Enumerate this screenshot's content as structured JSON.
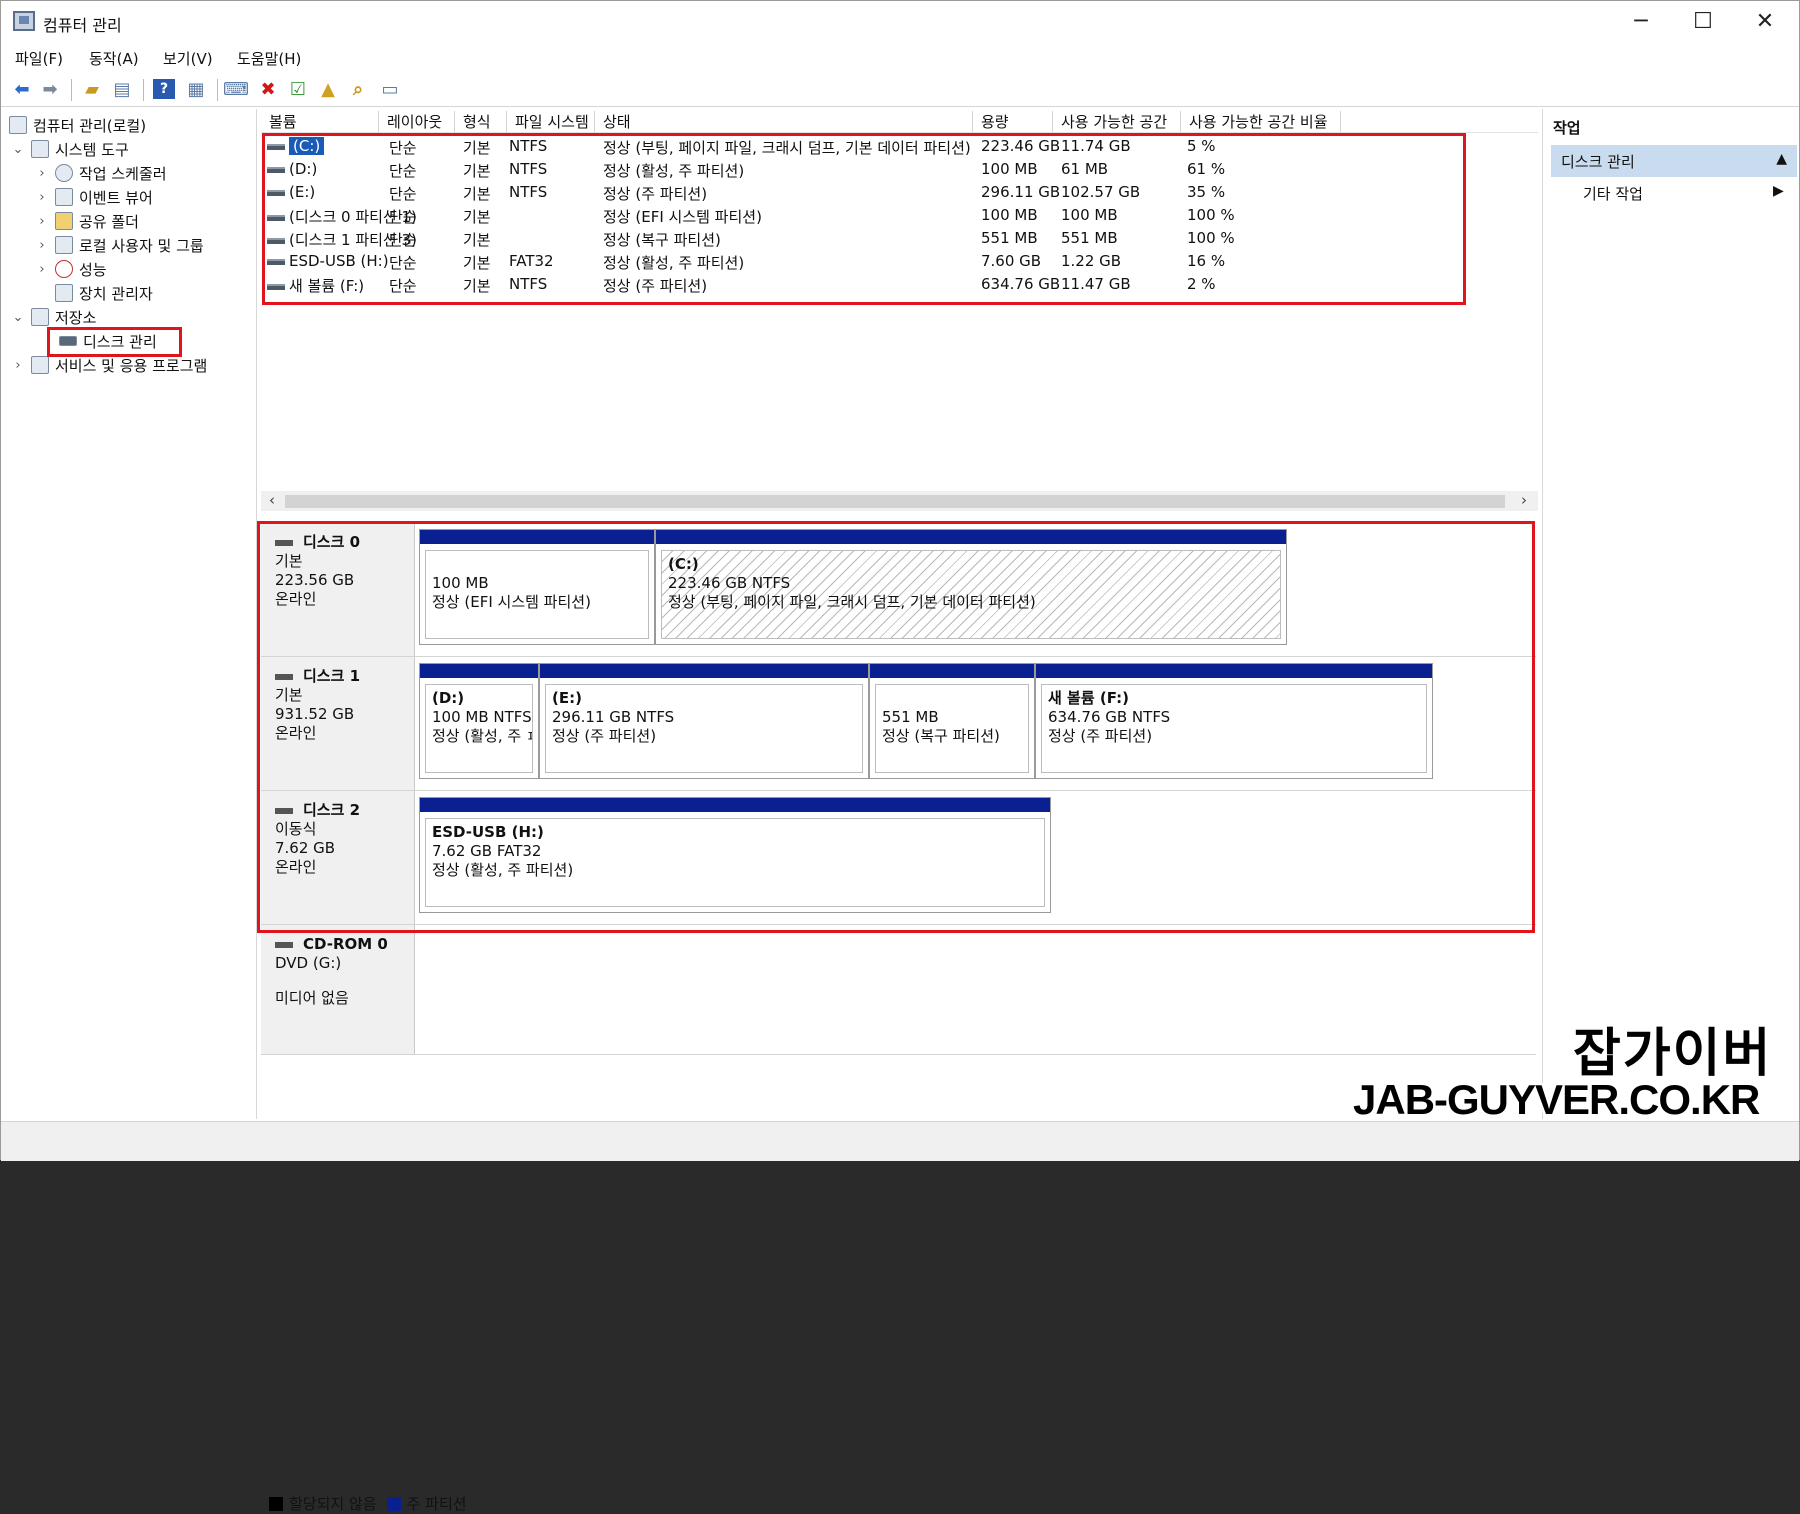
{
  "window": {
    "title": "컴퓨터 관리",
    "minimize": "─",
    "maximize": "☐",
    "close": "✕"
  },
  "menu": [
    "파일(F)",
    "동작(A)",
    "보기(V)",
    "도움말(H)"
  ],
  "tree": {
    "root": "컴퓨터 관리(로컬)",
    "system_tools": "시스템 도구",
    "task_scheduler": "작업 스케줄러",
    "event_viewer": "이벤트 뷰어",
    "shared_folders": "공유 폴더",
    "local_users": "로컬 사용자 및 그룹",
    "performance": "성능",
    "device_manager": "장치 관리자",
    "storage": "저장소",
    "disk_management": "디스크 관리",
    "services": "서비스 및 응용 프로그램"
  },
  "volume_table": {
    "headers": [
      "볼륨",
      "레이아웃",
      "형식",
      "파일 시스템",
      "상태",
      "용량",
      "사용 가능한 공간",
      "사용 가능한 공간 비율"
    ],
    "rows": [
      {
        "volume": "(C:)",
        "layout": "단순",
        "type": "기본",
        "fs": "NTFS",
        "status": "정상 (부팅, 페이지 파일, 크래시 덤프, 기본 데이터 파티션)",
        "capacity": "223.46 GB",
        "free": "11.74 GB",
        "pct": "5 %"
      },
      {
        "volume": "(D:)",
        "layout": "단순",
        "type": "기본",
        "fs": "NTFS",
        "status": "정상 (활성, 주 파티션)",
        "capacity": "100 MB",
        "free": "61 MB",
        "pct": "61 %"
      },
      {
        "volume": "(E:)",
        "layout": "단순",
        "type": "기본",
        "fs": "NTFS",
        "status": "정상 (주 파티션)",
        "capacity": "296.11 GB",
        "free": "102.57 GB",
        "pct": "35 %"
      },
      {
        "volume": "(디스크 0 파티션 1)",
        "layout": "단순",
        "type": "기본",
        "fs": "",
        "status": "정상 (EFI 시스템 파티션)",
        "capacity": "100 MB",
        "free": "100 MB",
        "pct": "100 %"
      },
      {
        "volume": "(디스크 1 파티션 3)",
        "layout": "단순",
        "type": "기본",
        "fs": "",
        "status": "정상 (복구 파티션)",
        "capacity": "551 MB",
        "free": "551 MB",
        "pct": "100 %"
      },
      {
        "volume": "ESD-USB (H:)",
        "layout": "단순",
        "type": "기본",
        "fs": "FAT32",
        "status": "정상 (활성, 주 파티션)",
        "capacity": "7.60 GB",
        "free": "1.22 GB",
        "pct": "16 %"
      },
      {
        "volume": "새 볼륨 (F:)",
        "layout": "단순",
        "type": "기본",
        "fs": "NTFS",
        "status": "정상 (주 파티션)",
        "capacity": "634.76 GB",
        "free": "11.47 GB",
        "pct": "2 %"
      }
    ]
  },
  "disks": [
    {
      "name": "디스크 0",
      "kind": "기본",
      "size": "223.56 GB",
      "state": "온라인",
      "parts": [
        {
          "name": "",
          "size": "100 MB",
          "status": "정상 (EFI 시스템 파티션)"
        },
        {
          "name": "(C:)",
          "size": "223.46 GB NTFS",
          "status": "정상 (부팅, 페이지 파일, 크래시 덤프, 기본 데이터 파티션)"
        }
      ]
    },
    {
      "name": "디스크 1",
      "kind": "기본",
      "size": "931.52 GB",
      "state": "온라인",
      "parts": [
        {
          "name": "(D:)",
          "size": "100 MB NTFS",
          "status": "정상 (활성, 주 ㅍ"
        },
        {
          "name": "(E:)",
          "size": "296.11 GB NTFS",
          "status": "정상 (주 파티션)"
        },
        {
          "name": "",
          "size": "551 MB",
          "status": "정상 (복구 파티션)"
        },
        {
          "name": "새 볼륨  (F:)",
          "size": "634.76 GB NTFS",
          "status": "정상 (주 파티션)"
        }
      ]
    },
    {
      "name": "디스크 2",
      "kind": "이동식",
      "size": "7.62 GB",
      "state": "온라인",
      "parts": [
        {
          "name": "ESD-USB  (H:)",
          "size": "7.62 GB FAT32",
          "status": "정상 (활성, 주 파티션)"
        }
      ]
    },
    {
      "name": "CD-ROM 0",
      "kind": "DVD (G:)",
      "size": "",
      "state": "미디어 없음",
      "parts": []
    }
  ],
  "legend": {
    "unallocated": "할당되지 않음",
    "primary": "주 파티션",
    "unallocated_color": "#000000",
    "primary_color": "#0a2090"
  },
  "actions": {
    "title": "작업",
    "section": "디스크 관리",
    "more": "기타 작업"
  },
  "watermark": {
    "line1": "잡가이버",
    "line2": "JAB-GUYVER.CO.KR"
  },
  "colors": {
    "highlight": "#e0141d",
    "partition_bar": "#0a2090",
    "selection": "#1a5bb8"
  },
  "icons": [
    "back-icon",
    "forward-icon",
    "up-folder-icon",
    "console-tree-icon",
    "help-icon",
    "properties-icon",
    "connect-icon",
    "delete-icon",
    "check-icon",
    "open-folder-icon",
    "search-folder-icon",
    "settings-icon"
  ]
}
